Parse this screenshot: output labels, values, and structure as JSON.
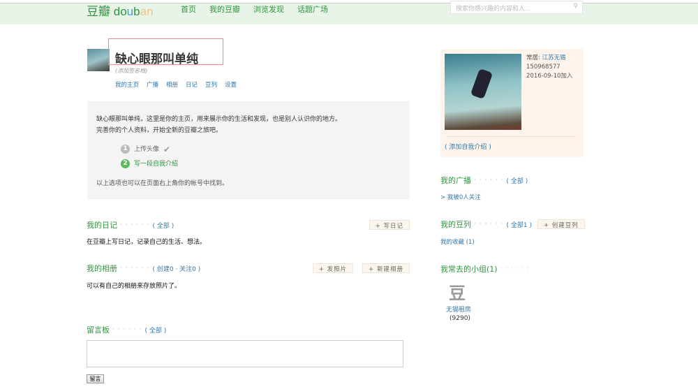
{
  "header": {
    "logo_cn": "豆瓣",
    "logo_en": [
      "d",
      "o",
      "u",
      "b",
      "a",
      "n"
    ],
    "nav": [
      "首页",
      "我的豆瓣",
      "浏览发现",
      "话题广场"
    ],
    "search_placeholder": "搜索你感兴趣的内容和人...",
    "search_icon": "search-icon"
  },
  "profile": {
    "name": "缺心眼那叫单纯",
    "signature": "(添加签名档)",
    "subnav": [
      "我的主页",
      "广播",
      "相册",
      "日记",
      "豆列",
      "设置"
    ]
  },
  "intro": {
    "line1": "缺心眼那叫单纯，这里是你的主页，用来展示你的生活和发现，也是别人认识你的地方。",
    "line2": "完善你的个人资料，开始全新的豆瓣之旅吧。",
    "steps": [
      {
        "num": "1",
        "label": "上传头像",
        "done": true
      },
      {
        "num": "2",
        "label": "写一段自我介绍",
        "done": false
      }
    ],
    "footer": "以上选项也可以在页面右上角你的帐号中找到。"
  },
  "diary": {
    "title": "我的日记",
    "dots": "· · · · · ·",
    "link": "( 全部 )",
    "button": "+ 写日记",
    "text": "在豆瓣上写日记，记录自己的生活、想法。"
  },
  "album": {
    "title": "我的相册",
    "dots": "· · · · · ·",
    "link": "( 创建0 · 关注0 )",
    "button1": "+ 发照片",
    "button2": "+ 新建相册",
    "text": "可以有自己的相册来存放照片了。"
  },
  "board": {
    "title": "留言板",
    "dots": "· · · · · ·",
    "link": "( 全部 )",
    "submit": "留言"
  },
  "card": {
    "location_label": "常居:",
    "location": "江苏无锡",
    "id": "150968577",
    "joined": "2016-09-10加入",
    "add_intro": "( 添加自我介绍 )"
  },
  "broadcast": {
    "title": "我的广播",
    "dots": "· · · · · ·",
    "link": "( 全部 )",
    "followers": "> 我被0人关注"
  },
  "doulist": {
    "title": "我的豆列",
    "dots": "· · · · · ·",
    "link": "( 全部1 )",
    "button": "+ 创建豆列",
    "fav": "我的收藏 (1)"
  },
  "groups": {
    "title": "我常去的小组(1)",
    "dots": "· · · · · ·",
    "items": [
      {
        "icon": "豆",
        "name": "无锡租房",
        "count": "(9290)"
      }
    ]
  }
}
